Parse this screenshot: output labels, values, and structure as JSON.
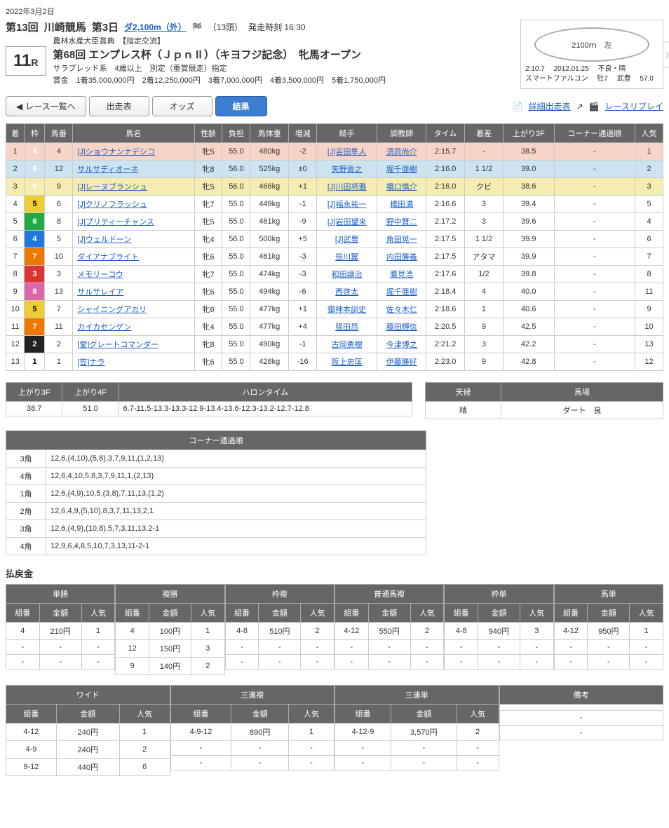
{
  "date": "2022年3月2日",
  "header": {
    "kaiji": "第13回",
    "place": "川崎競馬",
    "day": "第3日",
    "course": "ダ2,100m（外）",
    "heads": "（13頭）",
    "start": "発走時刻 16:30",
    "subtitle": "農林水産大臣賞典　【指定交流】",
    "raceNumber": "11",
    "raceR": "R",
    "raceName": "第68回 エンプレス杯（ＪｐｎⅡ）（キヨフジ記念）　牝馬オープン",
    "class": "サラブレッド系　4歳以上　別定（重賞競走）指定",
    "prize": "賞金　1着35,000,000円　2着12,250,000円　3着7,000,000円　4着3,500,000円　5着1,750,000円"
  },
  "track": {
    "dist": "2100ｍ　左",
    "rec_time": "2:10.7",
    "rec_date": "2012.01.25",
    "rec_cond": "不良・晴",
    "rec_horse": "スマートファルコン",
    "rec_age": "牡7",
    "rec_jockey": "武豊",
    "rec_weight": "57.0"
  },
  "tabs": {
    "back": "レース一覧へ",
    "entry": "出走表",
    "odds": "オッズ",
    "result": "結果",
    "detail": "詳細出走表",
    "replay": "レースリプレイ"
  },
  "cols": [
    "着",
    "枠",
    "馬番",
    "馬名",
    "性齢",
    "負担",
    "馬体重",
    "増減",
    "騎手",
    "調教師",
    "タイム",
    "着差",
    "上がり3F",
    "コーナー通過順",
    "人気"
  ],
  "rows": [
    {
      "pl": "1",
      "wk": 4,
      "no": "4",
      "horse": "[J]ショウナンナデシコ",
      "sa": "牝5",
      "wt": "55.0",
      "bw": "480kg",
      "df": "-2",
      "jk": "[J]吉田隼人",
      "tr": "須貝尚介",
      "tm": "2:15.7",
      "mg": "-",
      "f3": "38.5",
      "cn": "-",
      "pp": "1"
    },
    {
      "pl": "2",
      "wk": 8,
      "no": "12",
      "horse": "サルサディオーネ",
      "sa": "牝8",
      "wt": "56.0",
      "bw": "525kg",
      "df": "±0",
      "jk": "矢野貴之",
      "tr": "堀千亜樹",
      "tm": "2:16.0",
      "mg": "1 1/2",
      "f3": "39.0",
      "cn": "-",
      "pp": "2"
    },
    {
      "pl": "3",
      "wk": 6,
      "no": "9",
      "horse": "[J]レーヌブランシュ",
      "sa": "牝5",
      "wt": "56.0",
      "bw": "466kg",
      "df": "+1",
      "jk": "[J]川田将雅",
      "tr": "橋口慎介",
      "tm": "2:16.0",
      "mg": "クビ",
      "f3": "38.6",
      "cn": "-",
      "pp": "3"
    },
    {
      "pl": "4",
      "wk": 5,
      "no": "6",
      "horse": "[J]クリノフラッシュ",
      "sa": "牝7",
      "wt": "55.0",
      "bw": "449kg",
      "df": "-1",
      "jk": "[J]福永祐一",
      "tr": "橋田満",
      "tm": "2:16.6",
      "mg": "3",
      "f3": "39.4",
      "cn": "-",
      "pp": "5"
    },
    {
      "pl": "5",
      "wk": 6,
      "no": "8",
      "horse": "[J]プリティーチャンス",
      "sa": "牝5",
      "wt": "55.0",
      "bw": "461kg",
      "df": "-9",
      "jk": "[J]岩田望来",
      "tr": "野中賢二",
      "tm": "2:17.2",
      "mg": "3",
      "f3": "39.6",
      "cn": "-",
      "pp": "4"
    },
    {
      "pl": "6",
      "wk": 4,
      "no": "5",
      "horse": "[J]ウェルドーン",
      "sa": "牝4",
      "wt": "56.0",
      "bw": "500kg",
      "df": "+5",
      "jk": "[J]武豊",
      "tr": "角田晃一",
      "tm": "2:17.5",
      "mg": "1 1/2",
      "f3": "39.9",
      "cn": "-",
      "pp": "6"
    },
    {
      "pl": "7",
      "wk": 7,
      "no": "10",
      "horse": "ダイアナブライト",
      "sa": "牝6",
      "wt": "55.0",
      "bw": "461kg",
      "df": "-3",
      "jk": "笹川翼",
      "tr": "内田勝義",
      "tm": "2:17.5",
      "mg": "アタマ",
      "f3": "39.9",
      "cn": "-",
      "pp": "7"
    },
    {
      "pl": "8",
      "wk": 3,
      "no": "3",
      "horse": "メモリーコウ",
      "sa": "牝7",
      "wt": "55.0",
      "bw": "474kg",
      "df": "-3",
      "jk": "和田譲治",
      "tr": "鷹見浩",
      "tm": "2:17.6",
      "mg": "1/2",
      "f3": "39.8",
      "cn": "-",
      "pp": "8"
    },
    {
      "pl": "9",
      "wk": 8,
      "no": "13",
      "horse": "サルサレイア",
      "sa": "牝6",
      "wt": "55.0",
      "bw": "494kg",
      "df": "-6",
      "jk": "西啓太",
      "tr": "堀千亜樹",
      "tm": "2:18.4",
      "mg": "4",
      "f3": "40.0",
      "cn": "-",
      "pp": "11"
    },
    {
      "pl": "10",
      "wk": 5,
      "no": "7",
      "horse": "シャイニングアカリ",
      "sa": "牝6",
      "wt": "55.0",
      "bw": "477kg",
      "df": "+1",
      "jk": "御神本訓史",
      "tr": "佐々木仁",
      "tm": "2:18.6",
      "mg": "1",
      "f3": "40.6",
      "cn": "-",
      "pp": "9"
    },
    {
      "pl": "11",
      "wk": 7,
      "no": "11",
      "horse": "カイカセンゲン",
      "sa": "牝4",
      "wt": "55.0",
      "bw": "477kg",
      "df": "+4",
      "jk": "張田昂",
      "tr": "藤田輝信",
      "tm": "2:20.5",
      "mg": "9",
      "f3": "42.5",
      "cn": "-",
      "pp": "10"
    },
    {
      "pl": "12",
      "wk": 2,
      "no": "2",
      "horse": "[愛]グレートコマンダー",
      "sa": "牝8",
      "wt": "55.0",
      "bw": "490kg",
      "df": "-1",
      "jk": "古岡勇樹",
      "tr": "今津博之",
      "tm": "2:21.2",
      "mg": "3",
      "f3": "42.2",
      "cn": "-",
      "pp": "13"
    },
    {
      "pl": "13",
      "wk": 1,
      "no": "1",
      "horse": "[笠]ナラ",
      "sa": "牝6",
      "wt": "55.0",
      "bw": "426kg",
      "df": "-16",
      "jk": "阪上忠匡",
      "tr": "伊藤勝好",
      "tm": "2:23.0",
      "mg": "9",
      "f3": "42.8",
      "cn": "-",
      "pp": "12"
    }
  ],
  "time_table": {
    "h1": "上がり3F",
    "h2": "上がり4F",
    "h3": "ハロンタイム",
    "h4": "天候",
    "h5": "馬場",
    "f3": "38.7",
    "f4": "51.0",
    "lap": "6.7-11.5-13.3-13.3-12.9-13.4-13.6-12.3-13.2-12.7-12.8",
    "weather": "晴",
    "track": "ダート　良"
  },
  "corner": {
    "title": "コーナー通過順",
    "rows": [
      {
        "c": "3角",
        "v": "12,6,(4,10),(5,8),3,7,9,11,(1,2,13)"
      },
      {
        "c": "4角",
        "v": "12,6,4,10,5,8,3,7,9,11,1,(2,13)"
      },
      {
        "c": "1角",
        "v": "12,6,(4,9),10,5,(3,8),7,11,13,(1,2)"
      },
      {
        "c": "2角",
        "v": "12,6,4,9,(5,10),8,3,7,11,13,2,1"
      },
      {
        "c": "3角",
        "v": "12,6,(4,9),(10,8),5,7,3,11,13,2-1"
      },
      {
        "c": "4角",
        "v": "12,9,6,4,8,5,10,7,3,13,11-2-1"
      }
    ]
  },
  "payout_title": "払戻金",
  "pay_head": {
    "kumi": "組番",
    "amt": "金額",
    "pop": "人気"
  },
  "pay_types": {
    "tan": "単勝",
    "fuku": "複勝",
    "wakuren": "枠複",
    "umaren": "普通馬複",
    "wakutan": "枠単",
    "umatan": "馬単",
    "wide": "ワイド",
    "sanrenpuku": "三連複",
    "sanrentan": "三連単",
    "bikou": "備考"
  },
  "payouts1": {
    "tan": [
      {
        "k": "4",
        "a": "210円",
        "p": "1"
      },
      {
        "k": "-",
        "a": "-",
        "p": "-"
      },
      {
        "k": "-",
        "a": "-",
        "p": "-"
      }
    ],
    "fuku": [
      {
        "k": "4",
        "a": "100円",
        "p": "1"
      },
      {
        "k": "12",
        "a": "150円",
        "p": "3"
      },
      {
        "k": "9",
        "a": "140円",
        "p": "2"
      }
    ],
    "wakuren": [
      {
        "k": "4-8",
        "a": "510円",
        "p": "2"
      },
      {
        "k": "-",
        "a": "-",
        "p": "-"
      },
      {
        "k": "-",
        "a": "-",
        "p": "-"
      }
    ],
    "umaren": [
      {
        "k": "4-12",
        "a": "550円",
        "p": "2"
      },
      {
        "k": "-",
        "a": "-",
        "p": "-"
      },
      {
        "k": "-",
        "a": "-",
        "p": "-"
      }
    ],
    "wakutan": [
      {
        "k": "4-8",
        "a": "940円",
        "p": "3"
      },
      {
        "k": "-",
        "a": "-",
        "p": "-"
      },
      {
        "k": "-",
        "a": "-",
        "p": "-"
      }
    ],
    "umatan": [
      {
        "k": "4-12",
        "a": "950円",
        "p": "1"
      },
      {
        "k": "-",
        "a": "-",
        "p": "-"
      },
      {
        "k": "-",
        "a": "-",
        "p": "-"
      }
    ]
  },
  "payouts2": {
    "wide": [
      {
        "k": "4-12",
        "a": "240円",
        "p": "1"
      },
      {
        "k": "4-9",
        "a": "240円",
        "p": "2"
      },
      {
        "k": "9-12",
        "a": "440円",
        "p": "6"
      }
    ],
    "sanrenpuku": [
      {
        "k": "4-9-12",
        "a": "890円",
        "p": "1"
      },
      {
        "k": "-",
        "a": "-",
        "p": "-"
      },
      {
        "k": "-",
        "a": "-",
        "p": "-"
      }
    ],
    "sanrentan": [
      {
        "k": "4-12-9",
        "a": "3,570円",
        "p": "2"
      },
      {
        "k": "-",
        "a": "-",
        "p": "-"
      },
      {
        "k": "-",
        "a": "-",
        "p": "-"
      }
    ],
    "bikou": [
      {
        "k": ""
      },
      {
        "k": "-"
      },
      {
        "k": "-"
      }
    ]
  }
}
